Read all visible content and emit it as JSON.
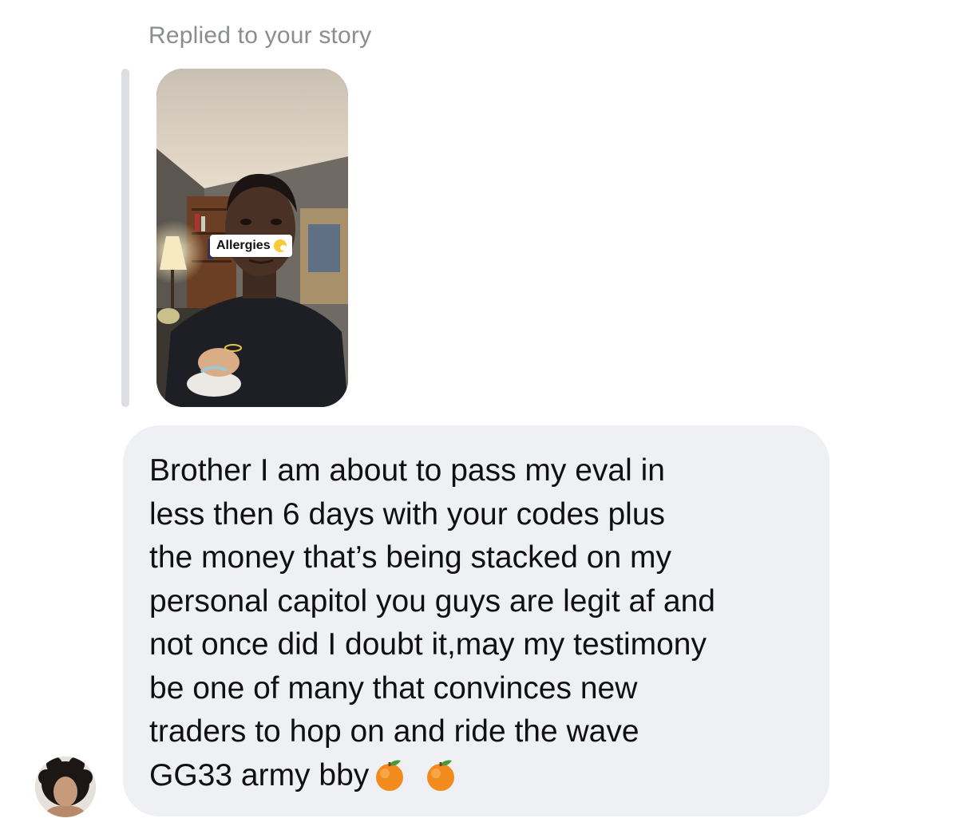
{
  "reply_header": "Replied to your story",
  "story": {
    "sticker_text": "Allergies",
    "sticker_icon": "sneezing-face-icon"
  },
  "message": {
    "text": "Brother I am about to pass my eval in\nless then 6 days with your codes plus\nthe money that’s being stacked on my\npersonal capitol you guys are legit af and\nnot once did I doubt it,may my testimony\nbe one of many that convinces new\ntraders to hop on and ride the wave\nGG33 army bby",
    "trailing_emojis": [
      "tangerine-icon",
      "tangerine-icon"
    ]
  },
  "colors": {
    "bubble_bg": "#eff0f3",
    "header_text": "#8a8d91",
    "quote_bar": "#dcdee2"
  }
}
